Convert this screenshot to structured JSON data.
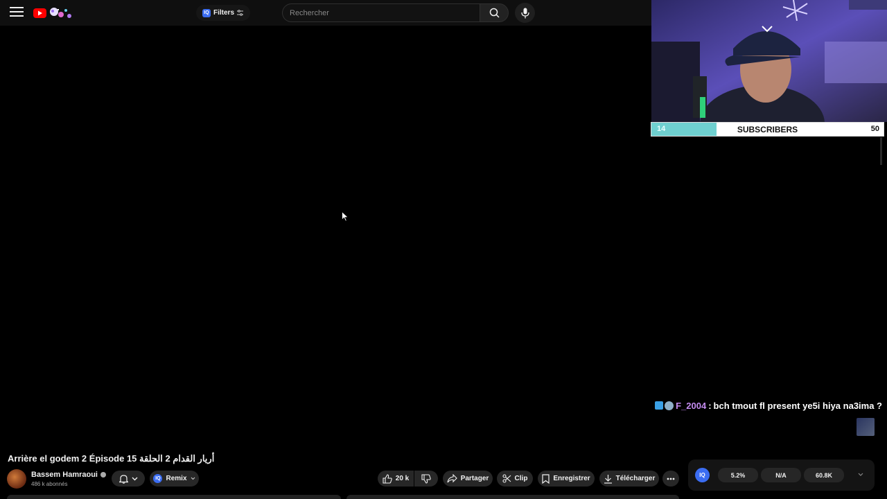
{
  "header": {
    "filters_label": "Filters",
    "iq_badge": "IQ",
    "search_placeholder": "Rechercher"
  },
  "overlay": {
    "subscriber_bar": {
      "current": "14",
      "label": "SUBSCRIBERS",
      "goal": "50",
      "progress_fraction": 0.28,
      "fill_color": "#6fd0d0"
    },
    "chat": {
      "user": "F_2004",
      "separator": ":",
      "message": "bch tmout fl present ye5i hiya na3ima ?",
      "user_color": "#c48cf0"
    }
  },
  "video": {
    "title": "Arrière el godem 2 Épisode 15 أريار القدام 2 الحلقة",
    "channel_name": "Bassem Hamraoui",
    "subscriber_count": "486 k abonnés"
  },
  "actions": {
    "remix": "Remix",
    "likes": "20 k",
    "share": "Partager",
    "clip": "Clip",
    "save": "Enregistrer",
    "download": "Télécharger"
  },
  "iq_stats": {
    "logo": "IQ",
    "stat1": "5.2%",
    "stat2": "N/A",
    "stat3": "60.8K"
  },
  "colors": {
    "background": "#000000",
    "accent": "#3b6df2",
    "youtube_red": "#ff0000"
  }
}
